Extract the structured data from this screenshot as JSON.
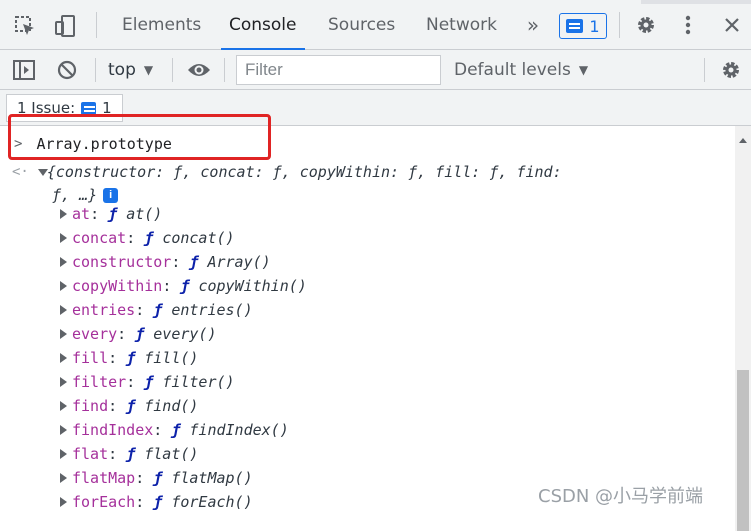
{
  "tabs": [
    {
      "label": "Elements"
    },
    {
      "label": "Console",
      "active": true
    },
    {
      "label": "Sources"
    },
    {
      "label": "Network"
    }
  ],
  "issues_badge_count": "1",
  "toolbar": {
    "context": "top",
    "filter_placeholder": "Filter",
    "levels": "Default levels"
  },
  "issues_bar": {
    "label": "1 Issue:",
    "count": "1"
  },
  "console": {
    "input": "Array.prototype",
    "preview_line1": "{constructor: ƒ, concat: ƒ, copyWithin: ƒ, fill: ƒ, find:",
    "preview_line2": "ƒ, …}",
    "info": "i",
    "fn_keyword": "ƒ",
    "properties": [
      {
        "key": "at",
        "fn": "at()"
      },
      {
        "key": "concat",
        "fn": "concat()"
      },
      {
        "key": "constructor",
        "fn": "Array()"
      },
      {
        "key": "copyWithin",
        "fn": "copyWithin()"
      },
      {
        "key": "entries",
        "fn": "entries()"
      },
      {
        "key": "every",
        "fn": "every()"
      },
      {
        "key": "fill",
        "fn": "fill()"
      },
      {
        "key": "filter",
        "fn": "filter()"
      },
      {
        "key": "find",
        "fn": "find()"
      },
      {
        "key": "findIndex",
        "fn": "findIndex()"
      },
      {
        "key": "flat",
        "fn": "flat()"
      },
      {
        "key": "flatMap",
        "fn": "flatMap()"
      },
      {
        "key": "forEach",
        "fn": "forEach()"
      }
    ]
  },
  "watermark": "CSDN @小马学前端",
  "colors": {
    "accent": "#1a73e8",
    "highlight_box": "#e02424",
    "property_key": "#a5309b",
    "fn_keyword": "#0d22aa"
  }
}
